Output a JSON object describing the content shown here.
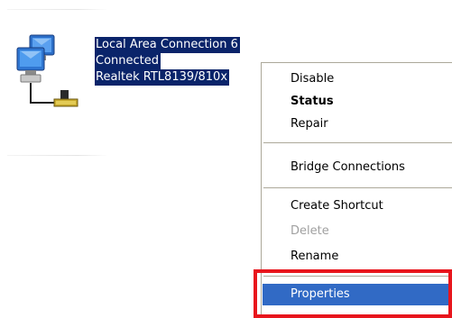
{
  "connection": {
    "name": "Local Area Connection 6",
    "status": "Connected",
    "device": "Realtek RTL8139/810x",
    "icon": "network-connection-icon"
  },
  "context_menu": {
    "items": [
      {
        "label": "Disable",
        "style": "normal"
      },
      {
        "label": "Status",
        "style": "bold"
      },
      {
        "label": "Repair",
        "style": "normal"
      },
      {
        "label": "Bridge Connections",
        "style": "normal"
      },
      {
        "label": "Create Shortcut",
        "style": "normal"
      },
      {
        "label": "Delete",
        "style": "disabled"
      },
      {
        "label": "Rename",
        "style": "normal"
      },
      {
        "label": "Properties",
        "style": "selected"
      }
    ],
    "selected_color": "#316ac5",
    "highlight_border_color": "#e8151c"
  }
}
